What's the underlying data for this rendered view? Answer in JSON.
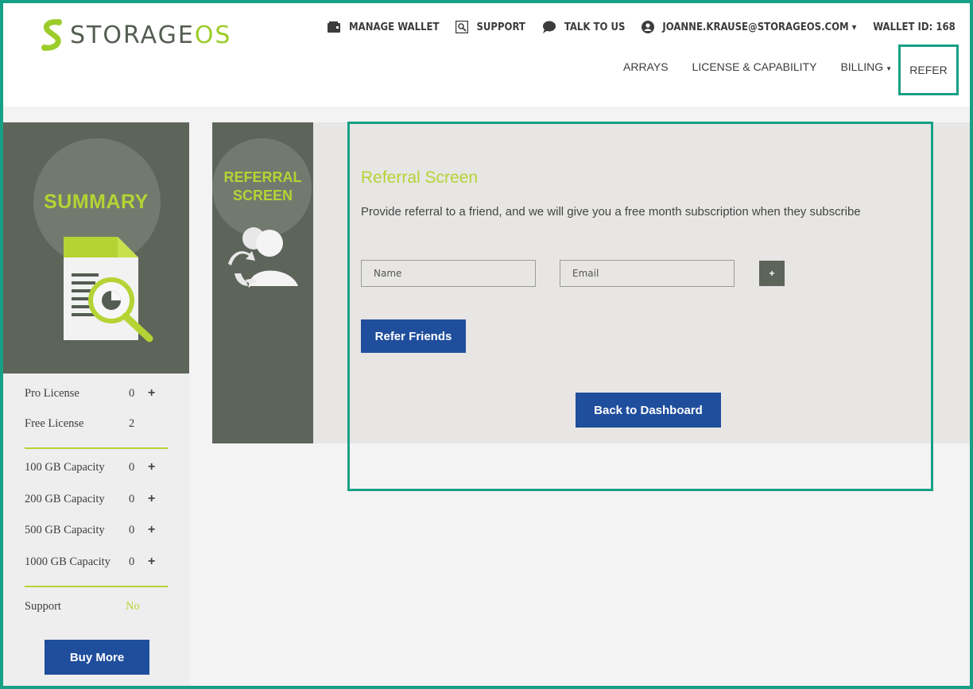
{
  "brand": {
    "logo_main": "STORAGE",
    "logo_accent": "OS",
    "accent_color": "#b5d334",
    "dark_panel": "#5d645a",
    "button_blue": "#1f4e9c",
    "highlight_color": "#16a085"
  },
  "topbar": {
    "manage_wallet": "MANAGE WALLET",
    "support": "SUPPORT",
    "talk_to_us": "TALK TO US",
    "user_email": "JOANNE.KRAUSE@STORAGEOS.COM",
    "wallet_id": "WALLET ID: 168"
  },
  "nav": {
    "arrays": "ARRAYS",
    "license": "LICENSE & CAPABILITY",
    "billing": "BILLING",
    "refer": "REFER"
  },
  "sidebar": {
    "title": "SUMMARY",
    "pro_license": {
      "label": "Pro License",
      "value": "0"
    },
    "free_license": {
      "label": "Free License",
      "value": "2"
    },
    "cap100": {
      "label": "100 GB Capacity",
      "value": "0"
    },
    "cap200": {
      "label": "200 GB Capacity",
      "value": "0"
    },
    "cap500": {
      "label": "500 GB Capacity",
      "value": "0"
    },
    "cap1000": {
      "label": "1000 GB Capacity",
      "value": "0"
    },
    "support": {
      "label": "Support",
      "value": "No"
    },
    "buy_more": "Buy More",
    "plus": "+"
  },
  "referral_panel": {
    "title_line1": "REFERRAL",
    "title_line2": "SCREEN"
  },
  "form": {
    "title": "Referral Screen",
    "description": "Provide referral to a friend, and we will give you a free month subscription when they subscribe",
    "name_placeholder": "Name",
    "email_placeholder": "Email",
    "add_label": "+",
    "refer_button": "Refer Friends",
    "back_button": "Back to Dashboard"
  }
}
